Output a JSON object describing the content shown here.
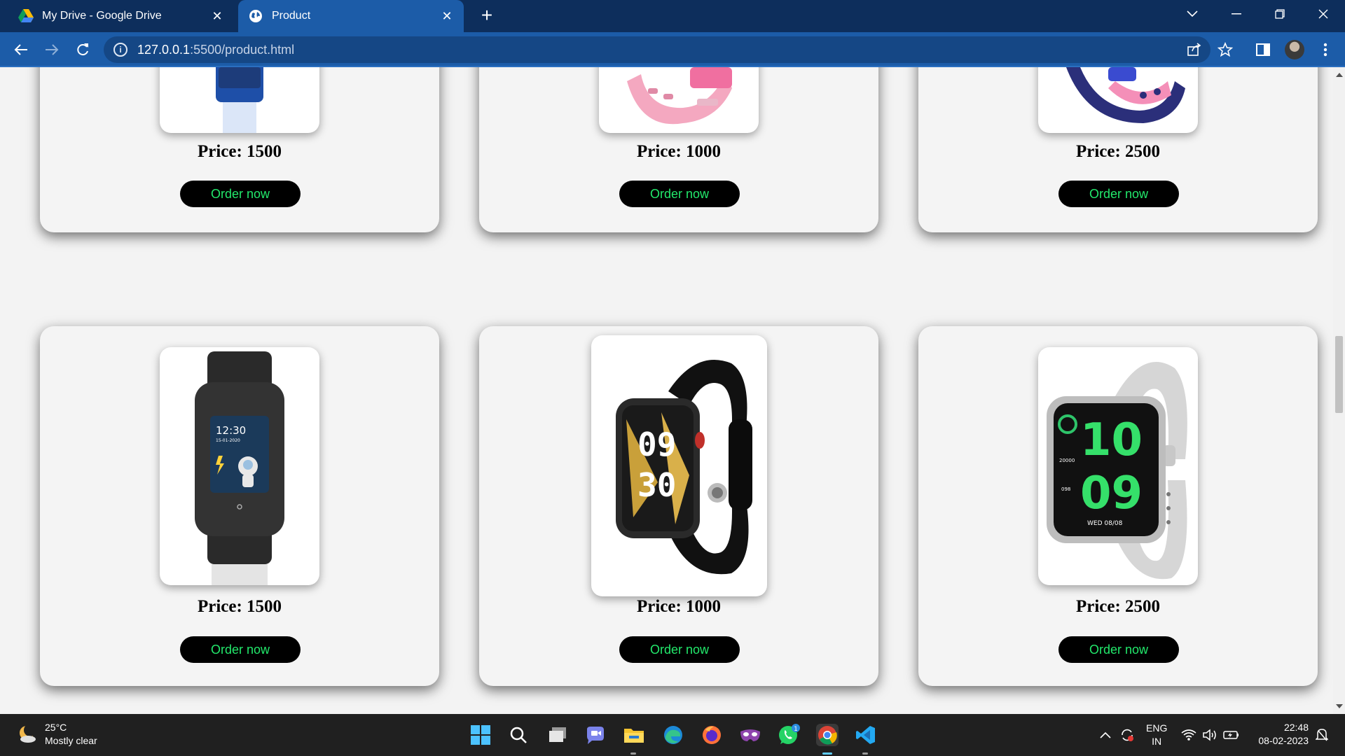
{
  "browser": {
    "tabs": [
      {
        "title": "My Drive - Google Drive",
        "active": false,
        "icon": "google-drive-icon"
      },
      {
        "title": "Product",
        "active": true,
        "icon": "globe-icon"
      }
    ],
    "new_tab": "+",
    "url_host": "127.0.0.1",
    "url_rest": ":5500/product.html"
  },
  "products": [
    {
      "price": "Price: 1500",
      "button": "Order now",
      "image": "blue-kids-smartwatch"
    },
    {
      "price": "Price: 1000",
      "button": "Order now",
      "image": "pink-smartwatch"
    },
    {
      "price": "Price: 2500",
      "button": "Order now",
      "image": "pink-navy-smartwatch"
    },
    {
      "price": "Price: 1500",
      "button": "Order now",
      "image": "black-kids-smartwatch"
    },
    {
      "price": "Price: 1000",
      "button": "Order now",
      "image": "black-smartwatch"
    },
    {
      "price": "Price: 2500",
      "button": "Order now",
      "image": "white-smartwatch"
    }
  ],
  "watch_faces": {
    "w4_time": "12:30",
    "w4_date": "15-01-2020",
    "w5_hour": "09",
    "w5_min": "30",
    "w6_hour": "10",
    "w6_min": "09",
    "w6_steps": "20000",
    "w6_hr": "098",
    "w6_date": "WED 08/08"
  },
  "colors": {
    "accent_button_text": "#22e86b",
    "button_bg": "#000000",
    "chrome_frame": "#0d2e5c",
    "chrome_toolbar": "#1c5ca8"
  },
  "taskbar": {
    "weather_temp": "25°C",
    "weather_desc": "Mostly clear",
    "lang_top": "ENG",
    "lang_bottom": "IN",
    "time": "22:48",
    "date": "08-02-2023",
    "whatsapp_badge": "1"
  }
}
